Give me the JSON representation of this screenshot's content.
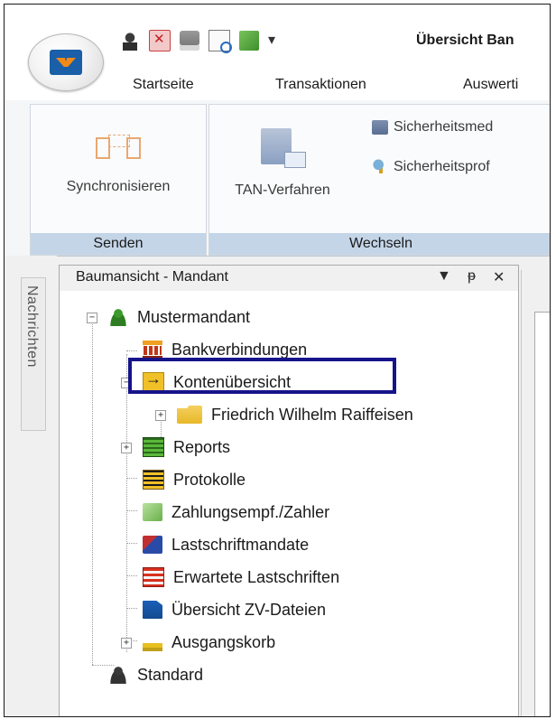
{
  "window": {
    "title": "Übersicht Ban"
  },
  "quick_access": {
    "icons": [
      "user-icon",
      "delete-icon",
      "print-icon",
      "print-preview-icon",
      "network-icon"
    ],
    "dropdown": "▾"
  },
  "tabs": [
    {
      "label": "Startseite"
    },
    {
      "label": "Transaktionen"
    },
    {
      "label": "Auswerti"
    }
  ],
  "ribbon": {
    "groups": [
      {
        "label": "Senden",
        "buttons": [
          {
            "label": "Synchronisieren",
            "icon": "sync-icon"
          }
        ]
      },
      {
        "label": "Wechseln",
        "buttons": [
          {
            "label": "TAN-Verfahren",
            "icon": "tan-device-icon"
          }
        ],
        "small_buttons": [
          {
            "label": "Sicherheitsmed",
            "icon": "security-media-icon"
          },
          {
            "label": "Sicherheitsprof",
            "icon": "security-profile-icon"
          }
        ]
      }
    ]
  },
  "side_tab": {
    "label": "Nachrichten"
  },
  "tree_panel": {
    "title": "Baumansicht - Mandant",
    "controls": {
      "dropdown": "▼",
      "pin": "ᵽ",
      "close": "✕"
    },
    "nodes": [
      {
        "label": "Mustermandant",
        "icon": "user-green-icon"
      },
      {
        "label": "Bankverbindungen",
        "icon": "bank-icon"
      },
      {
        "label": "Kontenübersicht",
        "icon": "accounts-arrow-icon"
      },
      {
        "label": "Friedrich Wilhelm Raiffeisen",
        "icon": "folder-icon"
      },
      {
        "label": "Reports",
        "icon": "reports-icon"
      },
      {
        "label": "Protokolle",
        "icon": "protocol-icon"
      },
      {
        "label": "Zahlungsempf./Zahler",
        "icon": "payee-icon"
      },
      {
        "label": "Lastschriftmandate",
        "icon": "direct-debit-mandate-icon"
      },
      {
        "label": "Erwartete Lastschriften",
        "icon": "expected-debits-icon"
      },
      {
        "label": "Übersicht ZV-Dateien",
        "icon": "payment-file-icon"
      },
      {
        "label": "Ausgangskorb",
        "icon": "outbox-icon"
      },
      {
        "label": "Standard",
        "icon": "user-dark-icon"
      }
    ],
    "expander_plus": "+",
    "expander_minus": "−"
  },
  "highlight": {
    "target": "Bankverbindungen",
    "color": "#16148a"
  }
}
